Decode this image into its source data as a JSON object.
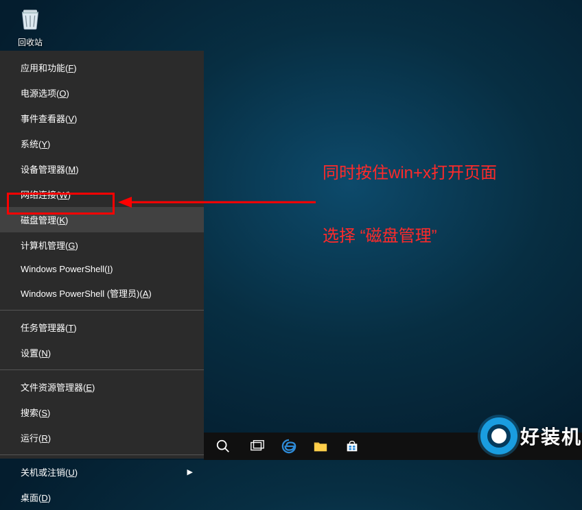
{
  "desktop": {
    "recycle_bin_label": "回收站"
  },
  "winx_menu": {
    "groups": [
      {
        "items": [
          {
            "label": "应用和功能(",
            "hot": "F",
            "suffix": ")"
          },
          {
            "label": "电源选项(",
            "hot": "O",
            "suffix": ")"
          },
          {
            "label": "事件查看器(",
            "hot": "V",
            "suffix": ")"
          },
          {
            "label": "系统(",
            "hot": "Y",
            "suffix": ")"
          },
          {
            "label": "设备管理器(",
            "hot": "M",
            "suffix": ")"
          },
          {
            "label": "网络连接(",
            "hot": "W",
            "suffix": ")"
          },
          {
            "label": "磁盘管理(",
            "hot": "K",
            "suffix": ")",
            "highlighted": true
          },
          {
            "label": "计算机管理(",
            "hot": "G",
            "suffix": ")"
          },
          {
            "label": "Windows PowerShell(",
            "hot": "I",
            "suffix": ")"
          },
          {
            "label": "Windows PowerShell (管理员)(",
            "hot": "A",
            "suffix": ")"
          }
        ]
      },
      {
        "items": [
          {
            "label": "任务管理器(",
            "hot": "T",
            "suffix": ")"
          },
          {
            "label": "设置(",
            "hot": "N",
            "suffix": ")"
          }
        ]
      },
      {
        "items": [
          {
            "label": "文件资源管理器(",
            "hot": "E",
            "suffix": ")"
          },
          {
            "label": "搜索(",
            "hot": "S",
            "suffix": ")"
          },
          {
            "label": "运行(",
            "hot": "R",
            "suffix": ")"
          }
        ]
      },
      {
        "items": [
          {
            "label": "关机或注销(",
            "hot": "U",
            "suffix": ")",
            "submenu": true
          },
          {
            "label": "桌面(",
            "hot": "D",
            "suffix": ")"
          }
        ]
      }
    ]
  },
  "annotations": {
    "line1": "同时按住win+x打开页面",
    "line2": "选择 “磁盘管理”"
  },
  "watermark": {
    "text": "好装机"
  },
  "colors": {
    "annotation": "#ff0000"
  }
}
